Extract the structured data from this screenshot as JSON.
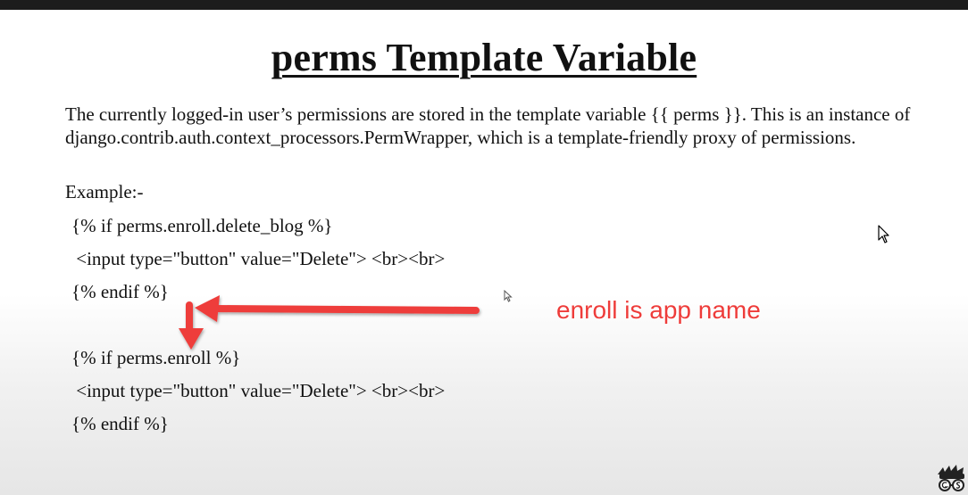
{
  "slide": {
    "title": "perms Template Variable",
    "paragraph": "The currently logged-in user’s permissions are stored in the template variable {{ perms }}. This is an instance of django.contrib.auth.context_processors.PermWrapper, which is a template-friendly proxy of permissions.",
    "example_label": "Example:-",
    "code_block_1": [
      "{% if perms.enroll.delete_blog %}",
      " <input type=\"button\" value=\"Delete\"> <br><br>",
      "{% endif %}"
    ],
    "code_block_2": [
      "{% if perms.enroll %}",
      " <input type=\"button\" value=\"Delete\"> <br><br>",
      "{% endif %}"
    ]
  },
  "annotation": {
    "text": "enroll is app name",
    "color": "#ee3c3a"
  },
  "icons": {
    "cursor": "mouse-pointer-icon",
    "logo": "geekyshows-logo-icon"
  }
}
